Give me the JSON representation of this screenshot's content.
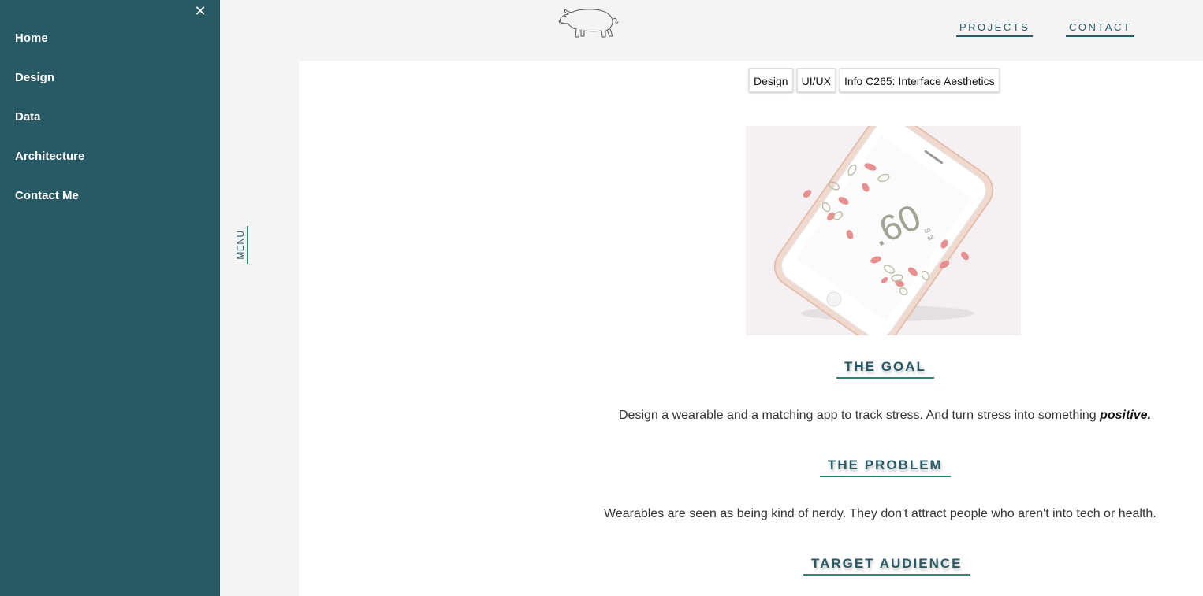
{
  "sidebar": {
    "close_symbol": "✕",
    "items": [
      {
        "label": "Home"
      },
      {
        "label": "Design"
      },
      {
        "label": "Data"
      },
      {
        "label": "Architecture"
      },
      {
        "label": "Contact Me"
      }
    ]
  },
  "menu_tab": {
    "label": "MENU"
  },
  "header": {
    "logo_icon": "pig-icon",
    "nav": {
      "projects": "PROJECTS",
      "contact": "CONTACT"
    }
  },
  "content": {
    "tags": [
      "Design",
      "UI/UX",
      "Info C265: Interface Aesthetics"
    ],
    "hero": {
      "readout_big": ".60",
      "readout_small_1": "60",
      "readout_small_2": "54"
    },
    "sections": {
      "goal_title": "THE GOAL",
      "goal_text": "Design a wearable and a matching app to track stress. And turn stress into something ",
      "goal_emphasis": "positive.",
      "problem_title": "THE PROBLEM",
      "problem_text": "Wearables are seen as being kind of nerdy. They don't attract people who aren't into tech or health.",
      "audience_title": "TARGET AUDIENCE"
    }
  },
  "colors": {
    "sidebar_bg": "#285a66",
    "accent_teal": "#2a8d73",
    "page_bg": "#f4f4f4"
  }
}
